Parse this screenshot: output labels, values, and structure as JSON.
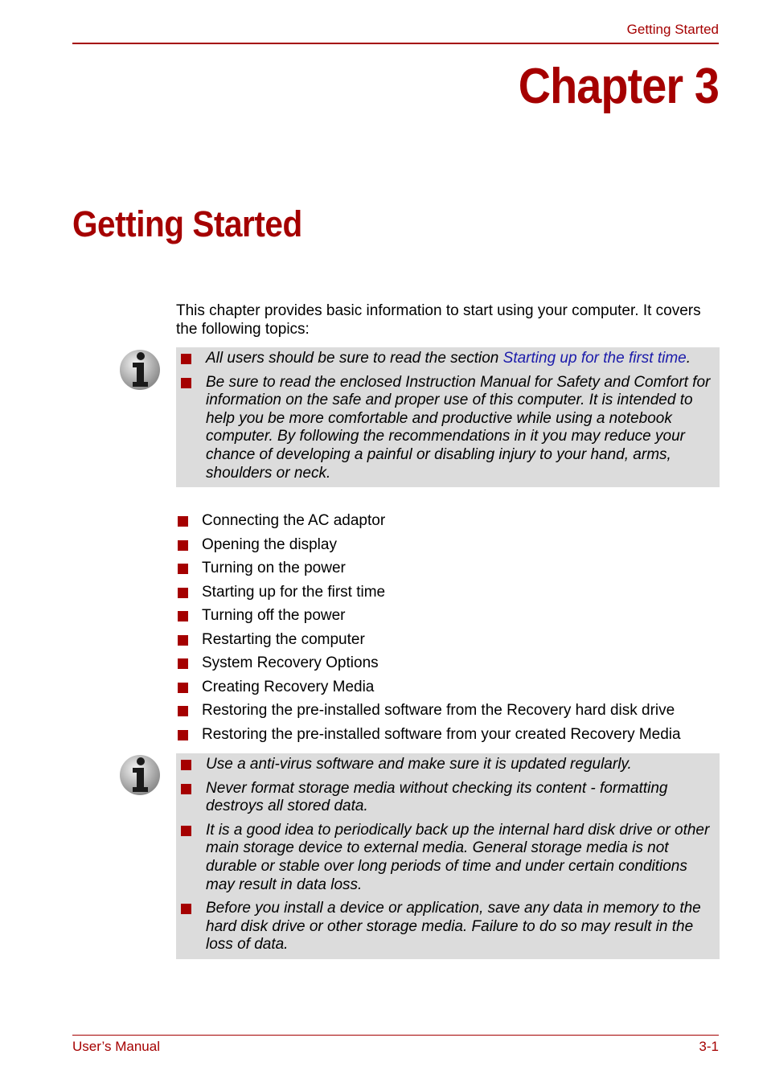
{
  "header": {
    "running_title": "Getting Started"
  },
  "chapter_label": "Chapter 3",
  "section_title": "Getting Started",
  "intro": "This chapter provides basic information to start using your computer. It covers the following topics:",
  "note1": {
    "icon": "info-icon",
    "items": [
      {
        "before": "All users should be sure to read the section ",
        "link": "Starting up for the first time",
        "after": "."
      },
      {
        "text": "Be sure to read the enclosed Instruction Manual for Safety and Comfort for information on the safe and proper use of this computer. It is intended to help you be more comfortable and productive while using a notebook computer. By following the recommendations in it you may reduce your chance of developing a painful or disabling injury to your hand, arms, shoulders or neck."
      }
    ]
  },
  "topics": [
    "Connecting the AC adaptor",
    "Opening the display",
    "Turning on the power",
    "Starting up for the first time",
    "Turning off the power",
    "Restarting the computer",
    "System Recovery Options",
    "Creating Recovery Media",
    "Restoring the pre-installed software from the Recovery hard disk drive",
    "Restoring the pre-installed software from your created Recovery Media"
  ],
  "note2": {
    "icon": "info-icon",
    "items": [
      "Use a anti-virus software and make sure it is updated regularly.",
      "Never format storage media without checking its content - formatting destroys all stored data.",
      "It is a good idea to periodically back up the internal hard disk drive or other main storage device to external media. General storage media is not durable or stable over long periods of time and under certain conditions may result in data loss.",
      "Before you install a device or application, save any data in memory to the hard disk drive or other storage media. Failure to do so may result in the loss of data."
    ]
  },
  "footer": {
    "left": "User’s Manual",
    "right": "3-1"
  },
  "colors": {
    "accent": "#a50000",
    "note_bg": "#dcdcdc",
    "link": "#1a1aaa"
  }
}
